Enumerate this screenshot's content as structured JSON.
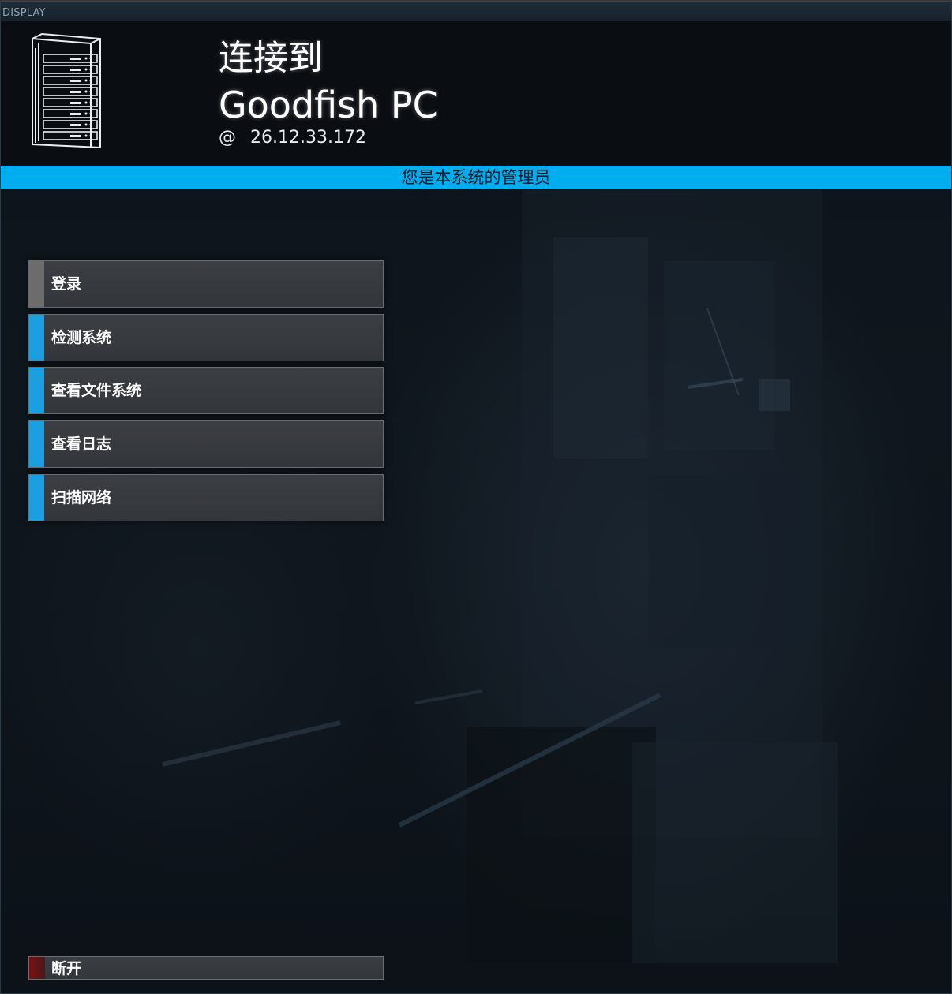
{
  "window": {
    "title": "DISPLAY"
  },
  "header": {
    "connect_label": "连接到",
    "host_name": "Goodfish PC",
    "at_symbol": "@",
    "host_ip": "26.12.33.172",
    "icon": "server-rack-icon"
  },
  "banner": {
    "text": "您是本系统的管理员",
    "color": "#00aef0"
  },
  "menu": {
    "items": [
      {
        "label": "登录",
        "accent": "#6c6c6c"
      },
      {
        "label": "检测系统",
        "accent": "#1a9fe0"
      },
      {
        "label": "查看文件系统",
        "accent": "#1a9fe0"
      },
      {
        "label": "查看日志",
        "accent": "#1a9fe0"
      },
      {
        "label": "扫描网络",
        "accent": "#1a9fe0"
      }
    ]
  },
  "disconnect": {
    "label": "断开",
    "accent": "#7a1010"
  }
}
